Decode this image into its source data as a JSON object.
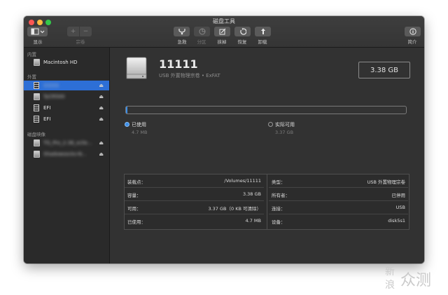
{
  "window": {
    "title": "磁盘工具"
  },
  "toolbar": {
    "view": {
      "label": "显示"
    },
    "volume": {
      "label": "宗卷",
      "add": "+",
      "remove": "−"
    },
    "first_aid": {
      "label": "急救"
    },
    "partition": {
      "label": "分区"
    },
    "erase": {
      "label": "抹掉"
    },
    "restore": {
      "label": "恢复"
    },
    "unmount": {
      "label": "卸载"
    },
    "info": {
      "label": "简介"
    }
  },
  "sidebar": {
    "internal_header": "内置",
    "internal": [
      {
        "label": "Macintosh HD"
      }
    ],
    "external_header": "外置",
    "external": [
      {
        "label": "11111",
        "selected": true,
        "blurred": true,
        "eject": "⏏"
      },
      {
        "label": "TyCR500",
        "blurred": true,
        "eject": "⏏"
      },
      {
        "label": "EFI",
        "eject": "⏏"
      },
      {
        "label": "EFI",
        "eject": "⏏"
      }
    ],
    "images_header": "磁盘映像",
    "images": [
      {
        "label": "TG_Pro_2.38_xclie...",
        "blurred": true,
        "eject": "⏏"
      },
      {
        "label": "Shadowsocks-N...",
        "blurred": true,
        "eject": "⏏"
      }
    ]
  },
  "volume": {
    "name": "11111",
    "subtitle": "USB 外置物理宗卷 • ExFAT",
    "size": "3.38 GB",
    "usage_fraction": 0.0014,
    "legend": {
      "used_label": "已使用",
      "used_value": "4.7 MB",
      "free_label": "实际可用",
      "free_value": "3.37 GB"
    }
  },
  "info": {
    "left": [
      {
        "key": "装载点：",
        "value": "/Volumes/11111"
      },
      {
        "key": "容量：",
        "value": "3.38 GB"
      },
      {
        "key": "可用：",
        "value": "3.37 GB（0 KB 可清除）"
      },
      {
        "key": "已使用：",
        "value": "4.7 MB"
      }
    ],
    "right": [
      {
        "key": "类型：",
        "value": "USB 外置物理宗卷"
      },
      {
        "key": "所有者：",
        "value": "已停用"
      },
      {
        "key": "连接：",
        "value": "USB"
      },
      {
        "key": "设备：",
        "value": "disk5s1"
      }
    ]
  },
  "watermark": {
    "line1": "新",
    "line2": "浪",
    "brand": "众测"
  },
  "colors": {
    "accent": "#2d6fd6",
    "used": "#3b8ee8",
    "window_bg": "#323232",
    "sidebar_bg": "#2a2a2a"
  }
}
